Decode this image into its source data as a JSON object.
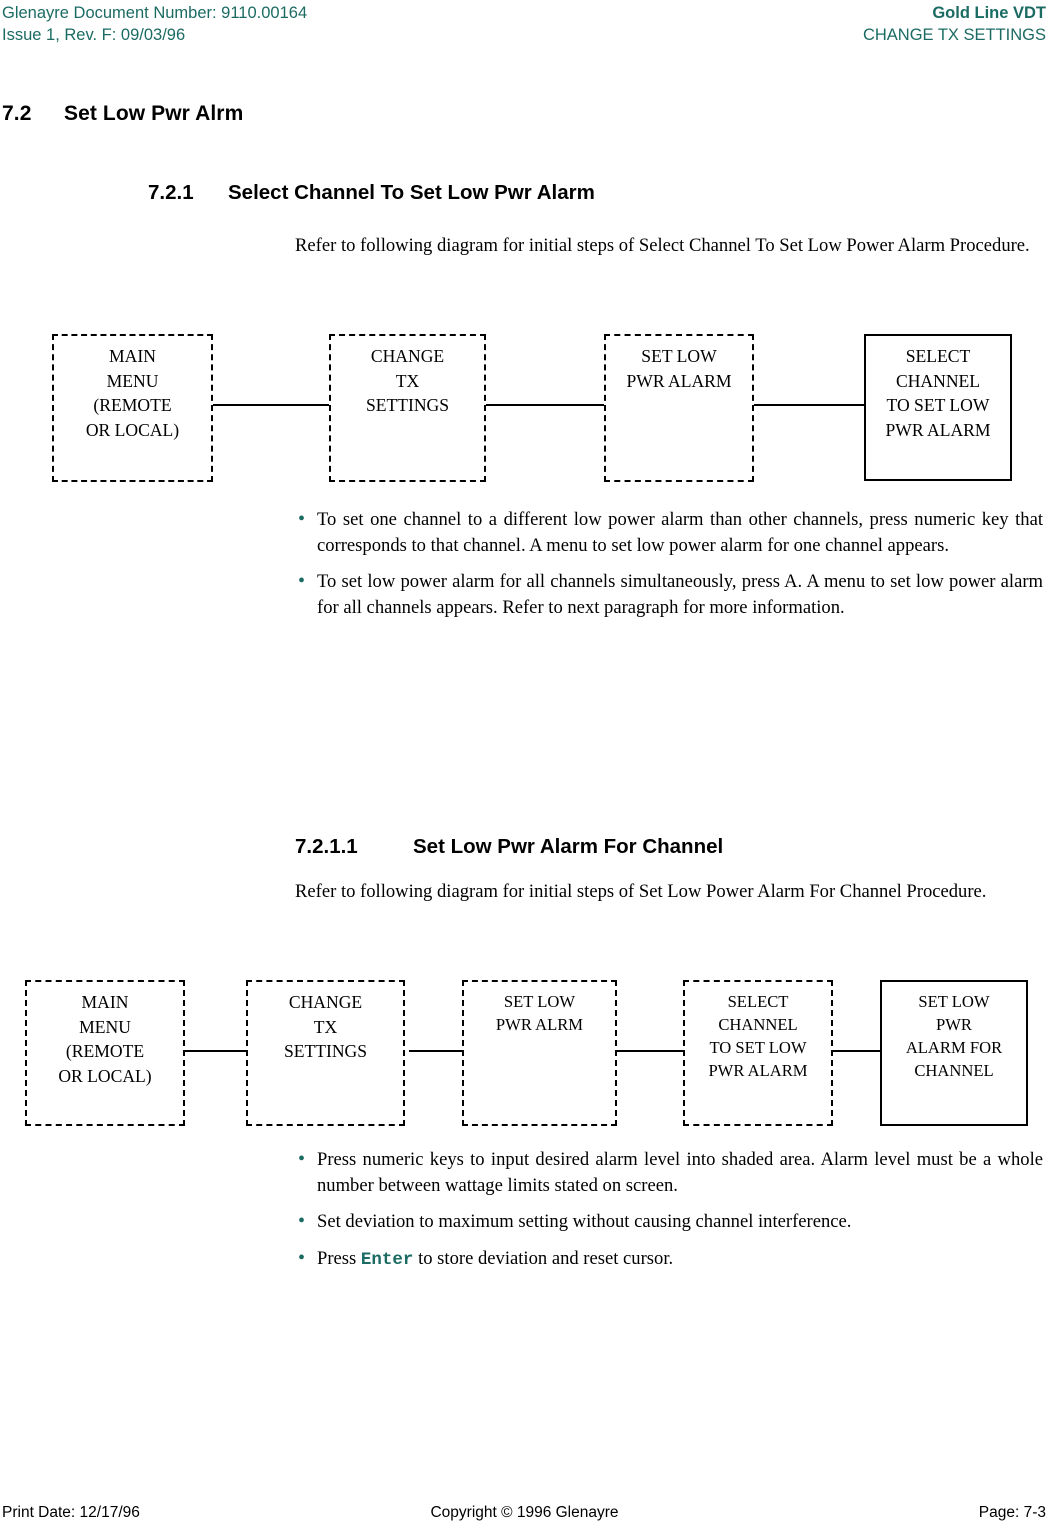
{
  "header": {
    "left_line1": "Glenayre Document Number: 9110.00164",
    "left_line2": "Issue 1, Rev. F: 09/03/96",
    "right_line1": "Gold Line VDT",
    "right_line2": "CHANGE TX SETTINGS",
    "accent_color": "#1b6b63"
  },
  "footer": {
    "print_date": "Print Date: 12/17/96",
    "copyright": "Copyright © 1996 Glenayre",
    "page": "Page: 7-3"
  },
  "sections": {
    "s72_num": "7.2",
    "s72_title": "Set Low Pwr Alrm",
    "s721_num": "7.2.1",
    "s721_title": "Select Channel To Set Low Pwr Alarm",
    "s721_intro": "Refer to following diagram for initial steps of Select Channel To Set Low Power Alarm Procedure.",
    "s7211_num": "7.2.1.1",
    "s7211_title": "Set Low Pwr Alarm For Channel",
    "s7211_intro": "Refer to following diagram for initial steps of Set Low Power Alarm For Channel Procedure."
  },
  "bullets_1": [
    "To set one channel to a different low power alarm than other channels, press numeric key that corresponds to that channel. A menu to set low power alarm for one channel  appears.",
    "To set low power alarm for all channels simultaneously, press A. A menu to set low power alarm for all channels appears. Refer to next paragraph for more information."
  ],
  "bullets_2": [
    "Press numeric keys to input desired alarm level into shaded area. Alarm level must be a whole number between wattage limits stated on screen.",
    "Set deviation to maximum setting without causing channel interference."
  ],
  "bullet_enter": {
    "prefix": "Press ",
    "key": "Enter",
    "suffix": " to store deviation and reset cursor."
  },
  "diagram_1": {
    "nodes": [
      {
        "text": "MAIN\nMENU\n(REMOTE\nOR LOCAL)",
        "style": "dashed"
      },
      {
        "text": "CHANGE\nTX\nSETTINGS",
        "style": "dashed"
      },
      {
        "text": "SET LOW\nPWR ALARM",
        "style": "dashed"
      },
      {
        "text": "SELECT\nCHANNEL\nTO SET LOW\nPWR ALARM",
        "style": "solid"
      }
    ]
  },
  "diagram_2": {
    "nodes": [
      {
        "text": "MAIN\nMENU\n(REMOTE\nOR LOCAL)",
        "style": "dashed"
      },
      {
        "text": "CHANGE\nTX\nSETTINGS",
        "style": "dashed"
      },
      {
        "text": "SET LOW\nPWR ALRM",
        "style": "dashed"
      },
      {
        "text": "SELECT\nCHANNEL\nTO SET LOW\nPWR ALARM",
        "style": "dashed"
      },
      {
        "text": "SET LOW\nPWR\nALARM FOR\nCHANNEL",
        "style": "solid"
      }
    ]
  }
}
